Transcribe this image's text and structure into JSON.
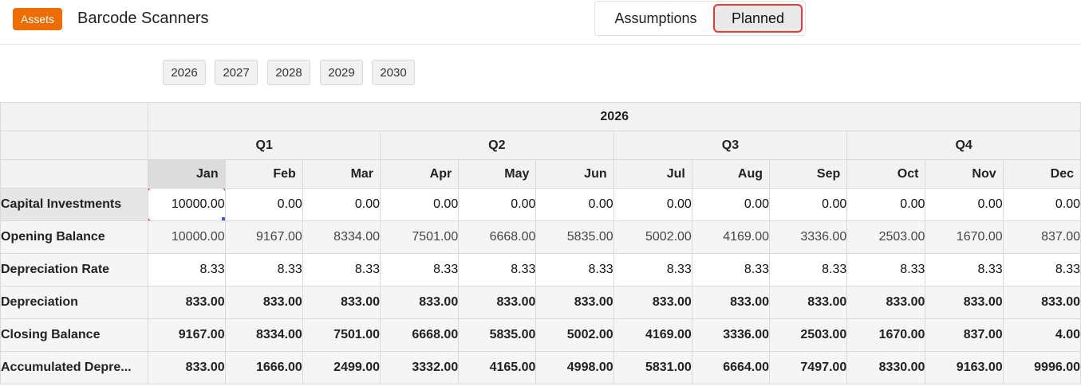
{
  "header": {
    "badge": "Assets",
    "title": "Barcode Scanners",
    "view_toggle": {
      "options": [
        "Assumptions",
        "Planned"
      ],
      "selected": "Planned"
    }
  },
  "years": [
    "2026",
    "2027",
    "2028",
    "2029",
    "2030"
  ],
  "table": {
    "year": "2026",
    "quarters": [
      "Q1",
      "Q2",
      "Q3",
      "Q4"
    ],
    "months": [
      "Jan",
      "Feb",
      "Mar",
      "Apr",
      "May",
      "Jun",
      "Jul",
      "Aug",
      "Sep",
      "Oct",
      "Nov",
      "Dec"
    ],
    "rows": [
      {
        "label": "Capital Investments",
        "values": [
          "10000.00",
          "0.00",
          "0.00",
          "0.00",
          "0.00",
          "0.00",
          "0.00",
          "0.00",
          "0.00",
          "0.00",
          "0.00",
          "0.00"
        ]
      },
      {
        "label": "Opening Balance",
        "values": [
          "10000.00",
          "9167.00",
          "8334.00",
          "7501.00",
          "6668.00",
          "5835.00",
          "5002.00",
          "4169.00",
          "3336.00",
          "2503.00",
          "1670.00",
          "837.00"
        ]
      },
      {
        "label": "Depreciation Rate",
        "values": [
          "8.33",
          "8.33",
          "8.33",
          "8.33",
          "8.33",
          "8.33",
          "8.33",
          "8.33",
          "8.33",
          "8.33",
          "8.33",
          "8.33"
        ]
      },
      {
        "label": "Depreciation",
        "values": [
          "833.00",
          "833.00",
          "833.00",
          "833.00",
          "833.00",
          "833.00",
          "833.00",
          "833.00",
          "833.00",
          "833.00",
          "833.00",
          "833.00"
        ]
      },
      {
        "label": "Closing Balance",
        "values": [
          "9167.00",
          "8334.00",
          "7501.00",
          "6668.00",
          "5835.00",
          "5002.00",
          "4169.00",
          "3336.00",
          "2503.00",
          "1670.00",
          "837.00",
          "4.00"
        ]
      },
      {
        "label": "Accumulated Depre...",
        "values": [
          "833.00",
          "1666.00",
          "2499.00",
          "3332.00",
          "4165.00",
          "4998.00",
          "5831.00",
          "6664.00",
          "7497.00",
          "8330.00",
          "9163.00",
          "9996.00"
        ]
      }
    ]
  }
}
